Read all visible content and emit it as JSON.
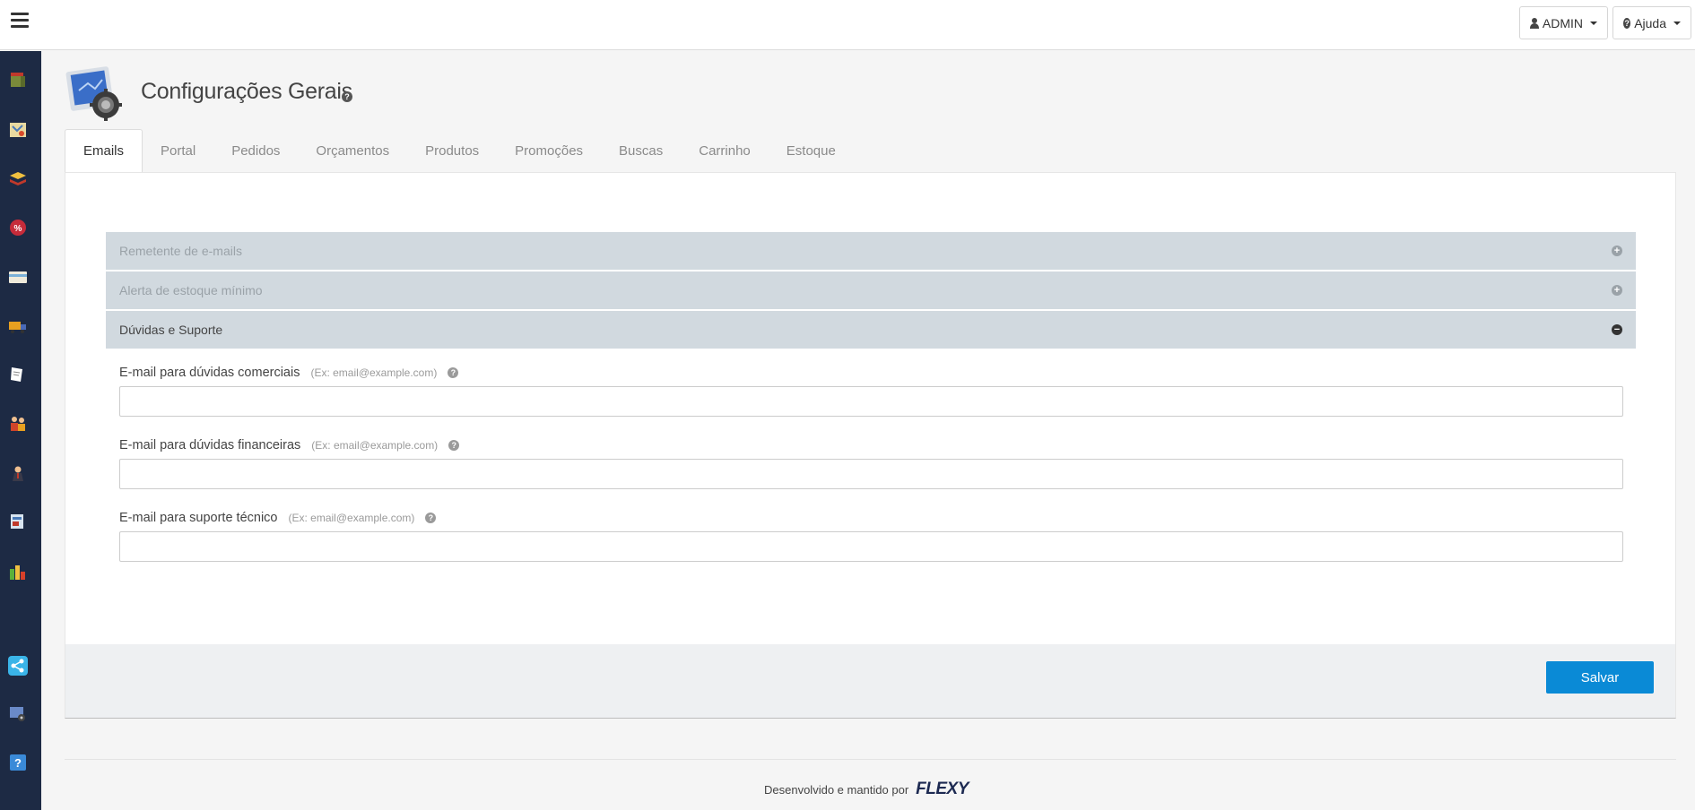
{
  "header": {
    "admin_label": "ADMIN",
    "help_label": "Ajuda"
  },
  "sidebar": {
    "items": [
      {
        "icon": "box-icon",
        "color": "#7a4a2a"
      },
      {
        "icon": "map-icon",
        "color": "#d8b868"
      },
      {
        "icon": "stack-icon",
        "color": "#d9a128"
      },
      {
        "icon": "discount-icon",
        "color": "#c62b3a"
      },
      {
        "icon": "card-icon",
        "color": "#e8e4d0"
      },
      {
        "icon": "truck-icon",
        "color": "#e0a020"
      },
      {
        "icon": "note-icon",
        "color": "#ffffff"
      },
      {
        "icon": "users-icon",
        "color": "#d0442a"
      },
      {
        "icon": "user-icon",
        "color": "#3a3a4a"
      },
      {
        "icon": "register-icon",
        "color": "#4a7ab8"
      },
      {
        "icon": "chart-icon",
        "color": "#5ab03a"
      },
      {
        "icon": "share-icon",
        "color": "#3ab4e8"
      },
      {
        "icon": "settings-icon",
        "color": "#6a8ac8"
      },
      {
        "icon": "help-icon",
        "color": "#3a8ad8"
      }
    ]
  },
  "page": {
    "title": "Configurações Gerais"
  },
  "tabs": [
    {
      "label": "Emails",
      "active": true
    },
    {
      "label": "Portal",
      "active": false
    },
    {
      "label": "Pedidos",
      "active": false
    },
    {
      "label": "Orçamentos",
      "active": false
    },
    {
      "label": "Produtos",
      "active": false
    },
    {
      "label": "Promoções",
      "active": false
    },
    {
      "label": "Buscas",
      "active": false
    },
    {
      "label": "Carrinho",
      "active": false
    },
    {
      "label": "Estoque",
      "active": false
    }
  ],
  "accordion": [
    {
      "label": "Remetente de e-mails",
      "open": false
    },
    {
      "label": "Alerta de estoque mínimo",
      "open": false
    },
    {
      "label": "Dúvidas e Suporte",
      "open": true
    }
  ],
  "fields": [
    {
      "label": "E-mail para dúvidas comerciais",
      "hint": "(Ex: email@example.com)",
      "value": ""
    },
    {
      "label": "E-mail para dúvidas financeiras",
      "hint": "(Ex: email@example.com)",
      "value": ""
    },
    {
      "label": "E-mail para suporte técnico",
      "hint": "(Ex: email@example.com)",
      "value": ""
    }
  ],
  "actions": {
    "save_label": "Salvar"
  },
  "footer": {
    "text": "Desenvolvido e mantido por",
    "brand": "FLEXY"
  },
  "colors": {
    "sidebar_bg": "#1d2a44",
    "accent": "#0a8ad6",
    "accordion_bg": "#d1d9df"
  }
}
